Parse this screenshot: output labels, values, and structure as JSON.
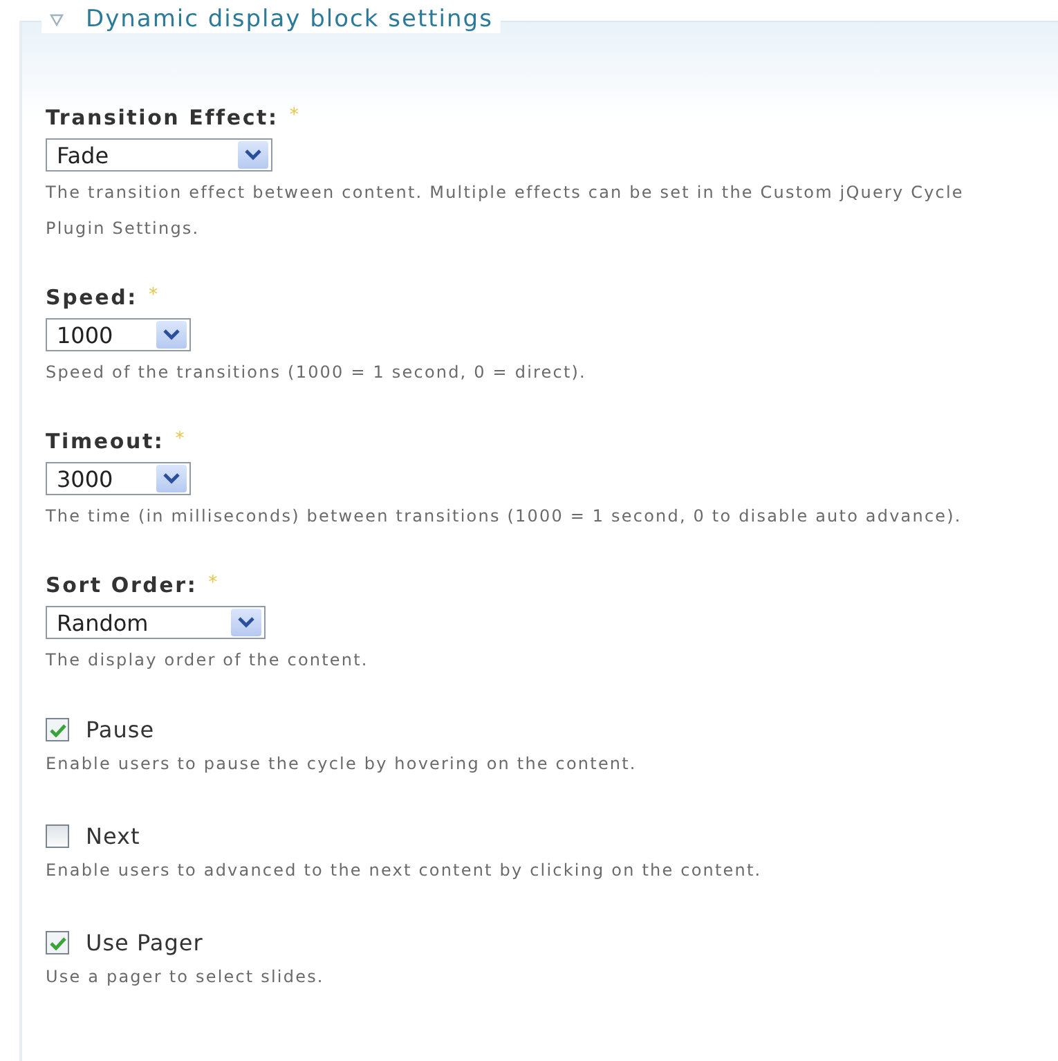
{
  "fieldset": {
    "legend": "Dynamic display block settings",
    "expanded": true
  },
  "fields": [
    {
      "kind": "select",
      "label": "Transition Effect:",
      "required_mark": "*",
      "value": "Fade",
      "description": "The transition effect between content. Multiple effects can be set in the Custom jQuery Cycle Plugin Settings."
    },
    {
      "kind": "select",
      "label": "Speed:",
      "required_mark": "*",
      "value": "1000",
      "description": "Speed of the transitions (1000 = 1 second, 0 = direct)."
    },
    {
      "kind": "select",
      "label": "Timeout:",
      "required_mark": "*",
      "value": "3000",
      "description": "The time (in milliseconds) between transitions (1000 = 1 second, 0 to disable auto advance)."
    },
    {
      "kind": "select",
      "label": "Sort Order:",
      "required_mark": "*",
      "value": "Random",
      "description": "The display order of the content."
    },
    {
      "kind": "checkbox",
      "label": "Pause",
      "checked": true,
      "description": "Enable users to pause the cycle by hovering on the content."
    },
    {
      "kind": "checkbox",
      "label": "Next",
      "checked": false,
      "description": "Enable users to advanced to the next content by clicking on the content."
    },
    {
      "kind": "checkbox",
      "label": "Use Pager",
      "checked": true,
      "description": "Use a pager to select slides."
    }
  ]
}
